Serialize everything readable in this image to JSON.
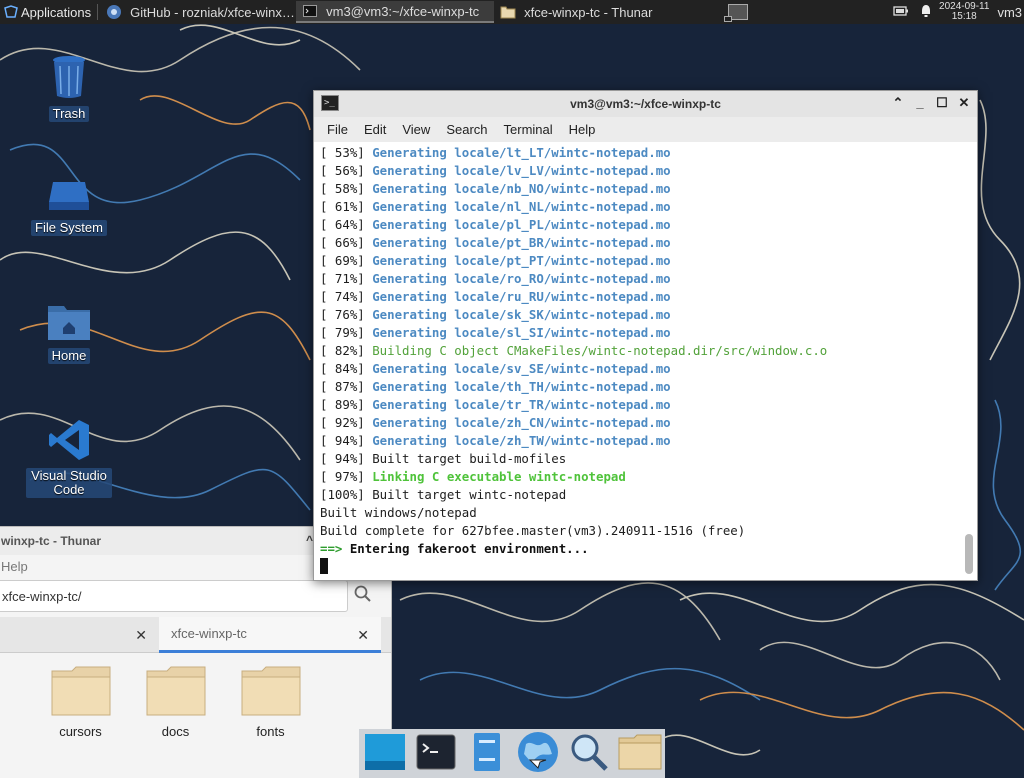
{
  "panel": {
    "apps_label": "Applications",
    "tasks": [
      {
        "label": "GitHub - rozniak/xfce-winx…",
        "icon": "chrome-icon",
        "active": false
      },
      {
        "label": "vm3@vm3:~/xfce-winxp-tc",
        "icon": "terminal-icon",
        "active": true
      },
      {
        "label": "xfce-winxp-tc - Thunar",
        "icon": "folder-icon",
        "active": false
      }
    ],
    "clock_date": "2024-09-11",
    "clock_time": "15:18",
    "user": "vm3"
  },
  "desktop_icons": [
    {
      "label": "Trash",
      "icon": "trash-icon"
    },
    {
      "label": "File System",
      "icon": "drive-icon"
    },
    {
      "label": "Home",
      "icon": "home-folder-icon"
    },
    {
      "label": "Visual Studio Code",
      "icon": "vscode-icon"
    }
  ],
  "thunar": {
    "title": "winxp-tc - Thunar",
    "menu": "Help",
    "location": "xfce-winxp-tc/",
    "tabs": [
      {
        "label": ""
      },
      {
        "label": "xfce-winxp-tc"
      }
    ],
    "files": [
      {
        "name": "cursors"
      },
      {
        "name": "docs"
      },
      {
        "name": "fonts"
      }
    ]
  },
  "terminal": {
    "title": "vm3@vm3:~/xfce-winxp-tc",
    "menu": [
      "File",
      "Edit",
      "View",
      "Search",
      "Terminal",
      "Help"
    ],
    "lines": [
      {
        "prefix": "[ 53%] ",
        "text": "Generating locale/lt_LT/wintc-notepad.mo",
        "style": "blue"
      },
      {
        "prefix": "[ 56%] ",
        "text": "Generating locale/lv_LV/wintc-notepad.mo",
        "style": "blue"
      },
      {
        "prefix": "[ 58%] ",
        "text": "Generating locale/nb_NO/wintc-notepad.mo",
        "style": "blue"
      },
      {
        "prefix": "[ 61%] ",
        "text": "Generating locale/nl_NL/wintc-notepad.mo",
        "style": "blue"
      },
      {
        "prefix": "[ 64%] ",
        "text": "Generating locale/pl_PL/wintc-notepad.mo",
        "style": "blue"
      },
      {
        "prefix": "[ 66%] ",
        "text": "Generating locale/pt_BR/wintc-notepad.mo",
        "style": "blue"
      },
      {
        "prefix": "[ 69%] ",
        "text": "Generating locale/pt_PT/wintc-notepad.mo",
        "style": "blue"
      },
      {
        "prefix": "[ 71%] ",
        "text": "Generating locale/ro_RO/wintc-notepad.mo",
        "style": "blue"
      },
      {
        "prefix": "[ 74%] ",
        "text": "Generating locale/ru_RU/wintc-notepad.mo",
        "style": "blue"
      },
      {
        "prefix": "[ 76%] ",
        "text": "Generating locale/sk_SK/wintc-notepad.mo",
        "style": "blue"
      },
      {
        "prefix": "[ 79%] ",
        "text": "Generating locale/sl_SI/wintc-notepad.mo",
        "style": "blue"
      },
      {
        "prefix": "[ 82%] ",
        "text": "Building C object CMakeFiles/wintc-notepad.dir/src/window.c.o",
        "style": "green"
      },
      {
        "prefix": "[ 84%] ",
        "text": "Generating locale/sv_SE/wintc-notepad.mo",
        "style": "blue"
      },
      {
        "prefix": "[ 87%] ",
        "text": "Generating locale/th_TH/wintc-notepad.mo",
        "style": "blue"
      },
      {
        "prefix": "[ 89%] ",
        "text": "Generating locale/tr_TR/wintc-notepad.mo",
        "style": "blue"
      },
      {
        "prefix": "[ 92%] ",
        "text": "Generating locale/zh_CN/wintc-notepad.mo",
        "style": "blue"
      },
      {
        "prefix": "[ 94%] ",
        "text": "Generating locale/zh_TW/wintc-notepad.mo",
        "style": "blue"
      },
      {
        "prefix": "[ 94%] ",
        "text": "Built target build-mofiles",
        "style": "plain"
      },
      {
        "prefix": "[ 97%] ",
        "text": "Linking C executable wintc-notepad",
        "style": "greenb"
      },
      {
        "prefix": "[100%] ",
        "text": "Built target wintc-notepad",
        "style": "plain"
      },
      {
        "prefix": "",
        "text": "Built windows/notepad",
        "style": "plain"
      },
      {
        "prefix": "",
        "text": "Build complete for 627bfee.master(vm3).240911-1516 (free)",
        "style": "plain"
      },
      {
        "prefix": "==> ",
        "text": "Entering fakeroot environment...",
        "style": "arrow"
      }
    ]
  },
  "dock": [
    {
      "icon": "desktop-icon"
    },
    {
      "icon": "terminal-icon"
    },
    {
      "icon": "file-manager-icon"
    },
    {
      "icon": "web-browser-icon"
    },
    {
      "icon": "app-finder-icon"
    },
    {
      "icon": "folder-icon"
    }
  ],
  "colors": {
    "wallpaper": "#17243a",
    "term_blue": "#4d8ac2",
    "term_green": "#52a23a",
    "accent": "#3c7fd8"
  }
}
